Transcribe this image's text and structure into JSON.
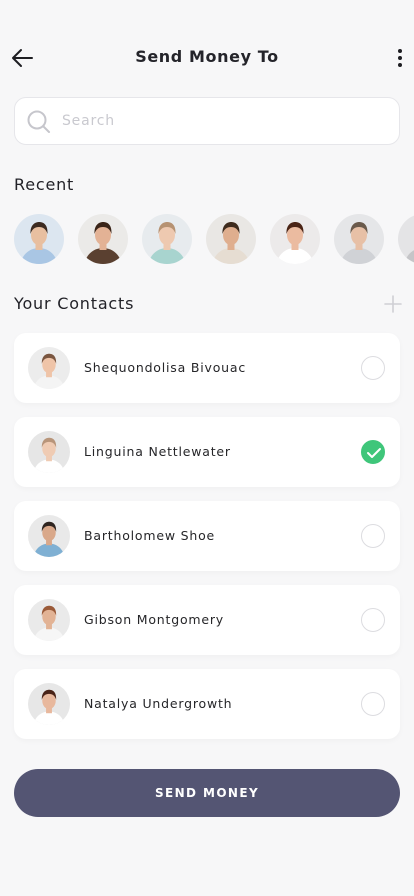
{
  "header": {
    "title": "Send Money To"
  },
  "search": {
    "placeholder": "Search",
    "value": ""
  },
  "recent": {
    "title": "Recent",
    "avatars": [
      {
        "bg": "#dce6f0",
        "hair": "#3b2a20",
        "skin": "#e8bfa0",
        "shirt": "#a9c6e4"
      },
      {
        "bg": "#ebeae8",
        "hair": "#3a2418",
        "skin": "#e3b295",
        "shirt": "#5a4030"
      },
      {
        "bg": "#e7ebee",
        "hair": "#b69272",
        "skin": "#eec9b0",
        "shirt": "#a8d4cf"
      },
      {
        "bg": "#e9e7e4",
        "hair": "#3e2b1d",
        "skin": "#dfae8e",
        "shirt": "#e6ddd2"
      },
      {
        "bg": "#eceaea",
        "hair": "#4a2416",
        "skin": "#ebbba0",
        "shirt": "#ffffff"
      },
      {
        "bg": "#e5e6e8",
        "hair": "#6a5a4b",
        "skin": "#e7c0a6",
        "shirt": "#d0d2d6"
      },
      {
        "bg": "#e4e4e6",
        "hair": "#888",
        "skin": "#d8d8da",
        "shirt": "#c5c5c8"
      }
    ]
  },
  "contacts": {
    "title": "Your Contacts",
    "items": [
      {
        "name": "Shequondolisa Bivouac",
        "selected": false,
        "bg": "#ececec",
        "hair": "#7a5640",
        "skin": "#efc4a8",
        "shirt": "#f4f4f4"
      },
      {
        "name": "Linguina Nettlewater",
        "selected": true,
        "bg": "#e6e6e6",
        "hair": "#b8957a",
        "skin": "#efcbb3",
        "shirt": "#ffffff"
      },
      {
        "name": "Bartholomew Shoe",
        "selected": false,
        "bg": "#e9e9e9",
        "hair": "#2f2520",
        "skin": "#d9a88a",
        "shirt": "#7fb0d3"
      },
      {
        "name": "Gibson Montgomery",
        "selected": false,
        "bg": "#eaeaea",
        "hair": "#9a5a38",
        "skin": "#e2b395",
        "shirt": "#f6f6f6"
      },
      {
        "name": "Natalya Undergrowth",
        "selected": false,
        "bg": "#e7e7e7",
        "hair": "#4a2418",
        "skin": "#e8b89d",
        "shirt": "#ffffff"
      }
    ]
  },
  "actions": {
    "send_label": "SEND MONEY"
  },
  "colors": {
    "accent": "#545573",
    "success": "#3fc67a"
  }
}
